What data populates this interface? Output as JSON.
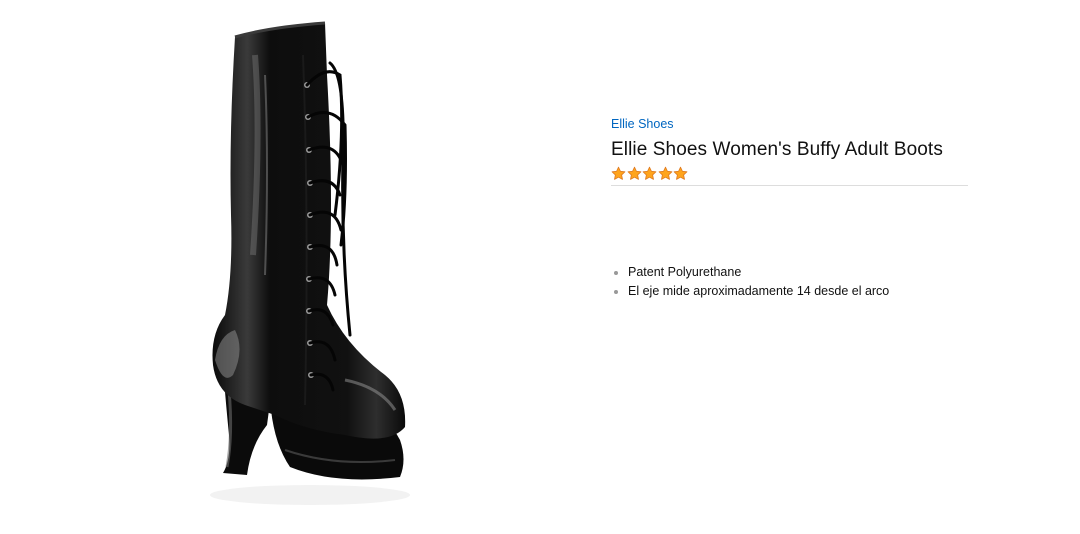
{
  "product": {
    "brand": "Ellie Shoes",
    "title": "Ellie Shoes Women's Buffy Adult Boots",
    "rating": 5,
    "rating_max": 5,
    "image_alt": "Black patent knee-high lace-up platform boot"
  },
  "features": [
    "Patent Polyurethane",
    "El eje mide aproximadamente 14 desde el arco"
  ],
  "colors": {
    "link": "#0066c0",
    "text": "#111111",
    "star": "#ffa41c",
    "divider": "#dddddd"
  },
  "icons": {
    "star": "star-icon"
  }
}
